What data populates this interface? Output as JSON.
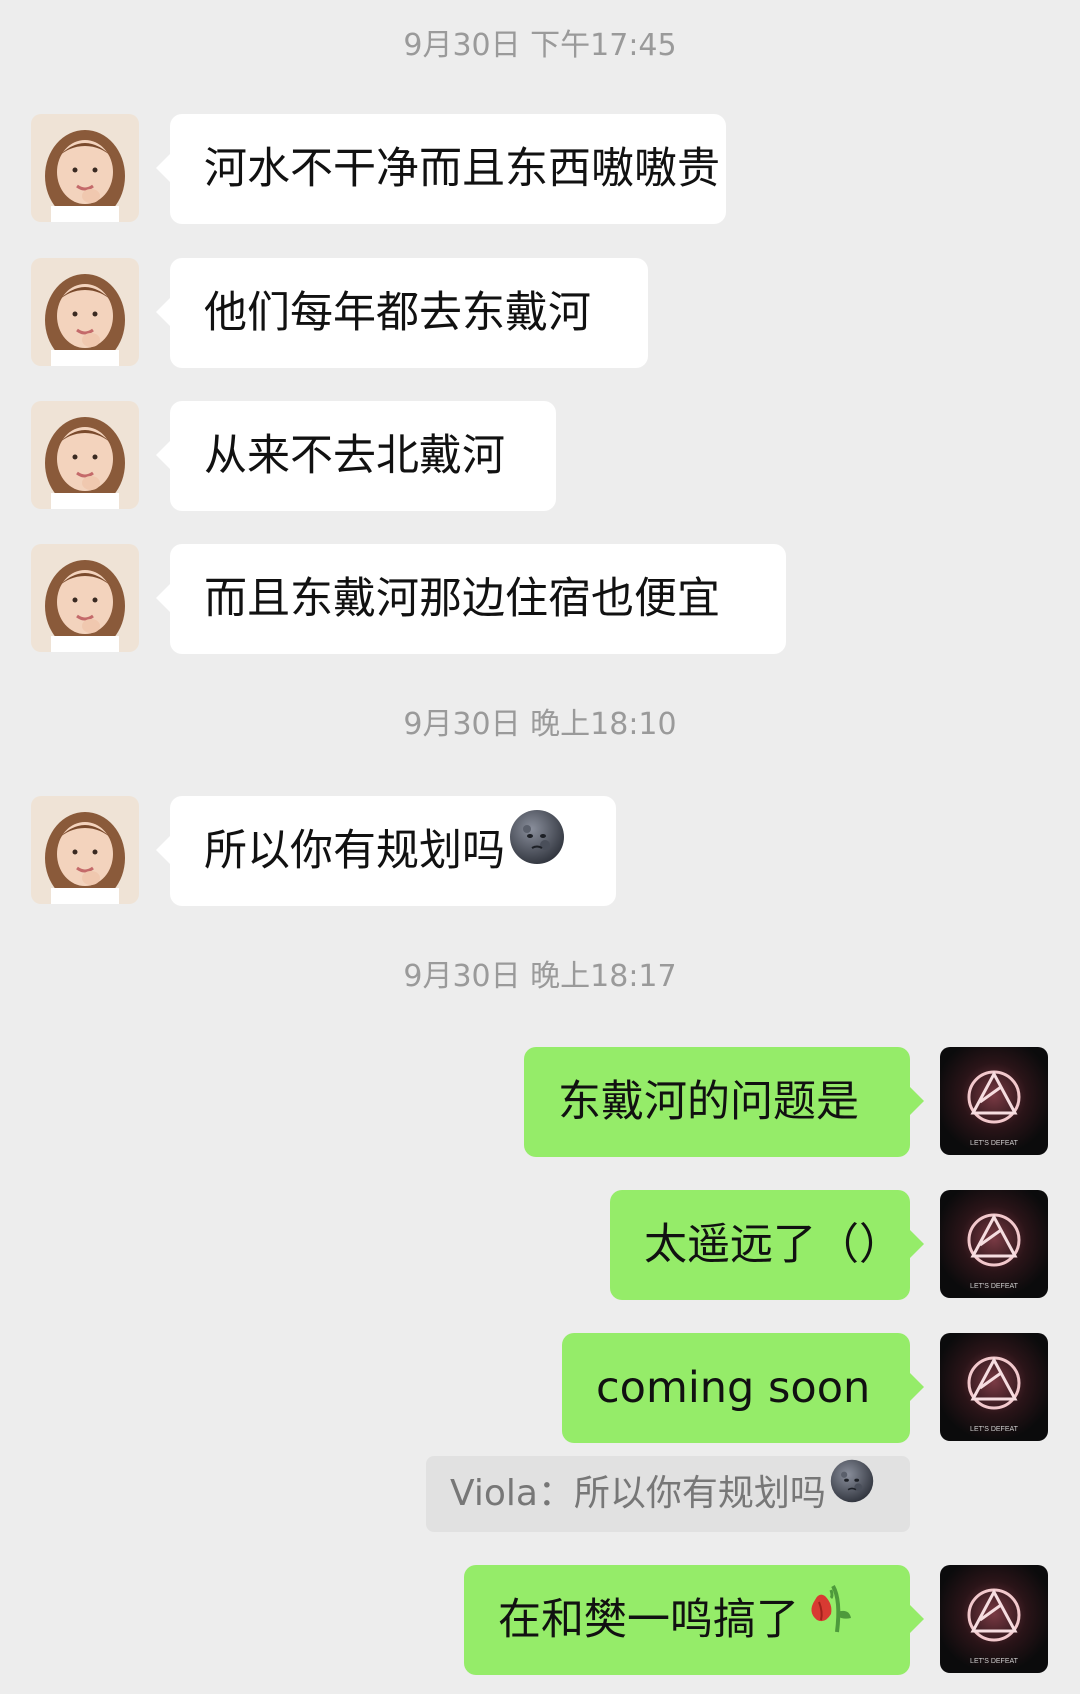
{
  "timestamps": [
    "9月30日 下午17:45",
    "9月30日 晚上18:10",
    "9月30日 晚上18:17"
  ],
  "messages": [
    {
      "side": "in",
      "text": "河水不干净而且东西嗷嗷贵"
    },
    {
      "side": "in",
      "text": "他们每年都去东戴河"
    },
    {
      "side": "in",
      "text": "从来不去北戴河"
    },
    {
      "side": "in",
      "text": "而且东戴河那边住宿也便宜"
    },
    {
      "side": "in",
      "text": "所以你有规划吗",
      "emoji": "new-moon-face-emoji"
    },
    {
      "side": "out",
      "text": "东戴河的问题是"
    },
    {
      "side": "out",
      "text": "太遥远了（）"
    },
    {
      "side": "out",
      "text": "coming soon"
    },
    {
      "side": "out",
      "text": "在和樊一鸣搞了",
      "emoji": "wilted-flower-emoji"
    }
  ],
  "quote": {
    "text": "Viola：所以你有规划吗",
    "emoji": "new-moon-face-emoji"
  },
  "avatars": {
    "contact": "girl-portrait-avatar",
    "self_logo_text": "LET'S DEFEAT",
    "self": "linkin-park-logo-avatar"
  },
  "colors": {
    "background": "#ededed",
    "incoming_bubble": "#ffffff",
    "outgoing_bubble": "#95ec69",
    "timestamp": "#9a9a9a"
  }
}
